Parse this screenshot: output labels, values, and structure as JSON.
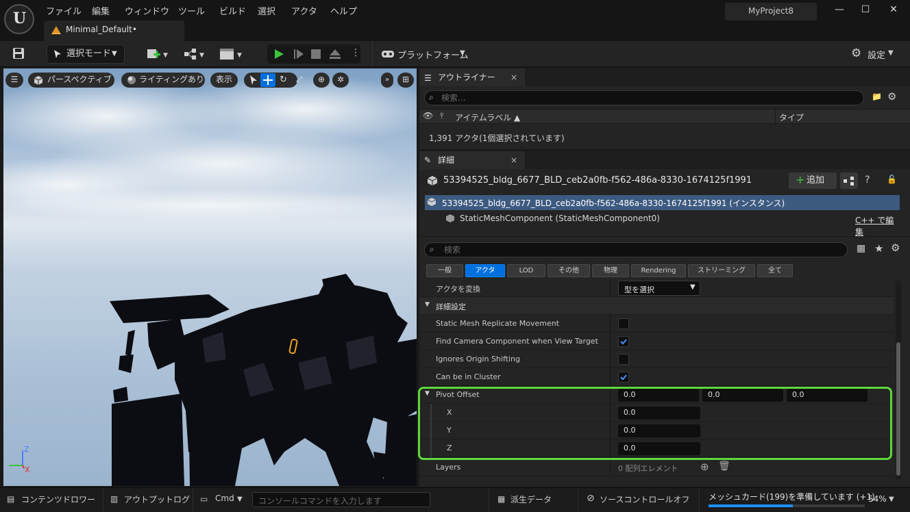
{
  "menu": {
    "items": [
      "ファイル",
      "編集",
      "ウィンドウ",
      "ツール",
      "ビルド",
      "選択",
      "アクタ",
      "ヘルプ"
    ],
    "doc_tab": "Minimal_Default•",
    "project_name": "MyProject8"
  },
  "toolbar": {
    "select_mode": "選択モード",
    "platform": "プラットフォーム",
    "settings": "設定"
  },
  "viewport": {
    "perspective": "パースペクティブ",
    "lighting": "ライティングあり",
    "show": "表示",
    "axis_z": "Z",
    "axis_x": "X"
  },
  "outliner": {
    "tab_label": "アウトライナー",
    "search_placeholder": "検索...",
    "col_item_label": "アイテムラベル ▲",
    "col_type": "タイプ",
    "actor_count": "1,391 アクタ(1個選択されています)"
  },
  "details": {
    "tab_label": "詳細",
    "actor_name": "53394525_bldg_6677_BLD_ceb2a0fb-f562-486a-8330-1674125f1991",
    "add_button": "追加",
    "instance_row": "53394525_bldg_6677_BLD_ceb2a0fb-f562-486a-8330-1674125f1991 (インスタンス)",
    "component_row": "StaticMeshComponent (StaticMeshComponent0)",
    "cpp_edit": "C++ で編集",
    "search_placeholder": "検索",
    "categories": [
      "一般",
      "アクタ",
      "LOD",
      "その他",
      "物理",
      "Rendering",
      "ストリーミング",
      "全て"
    ],
    "convert_actor_label": "アクタを変換",
    "convert_actor_value": "型を選択",
    "advanced_section": "詳細設定",
    "props": {
      "static_mesh_replicate": {
        "label": "Static Mesh Replicate Movement",
        "checked": false
      },
      "find_camera": {
        "label": "Find Camera Component when View Target",
        "checked": true
      },
      "ignores_origin": {
        "label": "Ignores Origin Shifting",
        "checked": false
      },
      "can_be_cluster": {
        "label": "Can be in Cluster",
        "checked": true
      }
    },
    "pivot_offset": {
      "label": "Pivot Offset",
      "x_label": "X",
      "y_label": "Y",
      "z_label": "Z",
      "x": "0.0",
      "y": "0.0",
      "z": "0.0"
    },
    "layers_label": "Layers",
    "layers_value": "0 配列エレメント"
  },
  "statusbar": {
    "content_drawer": "コンテンツドロワー",
    "output_log": "アウトプットログ",
    "cmd": "Cmd",
    "console_placeholder": "コンソールコマンドを入力します",
    "derived_data": "派生データ",
    "source_control": "ソースコントロールオフ",
    "progress_text": "メッシュカード(199)を準備しています (+1)",
    "progress_percent": "54%",
    "progress_fraction": 0.54
  },
  "colors": {
    "accent_blue": "#0070e0",
    "highlight_green": "#5fd83c",
    "play_green": "#3dc23d"
  }
}
